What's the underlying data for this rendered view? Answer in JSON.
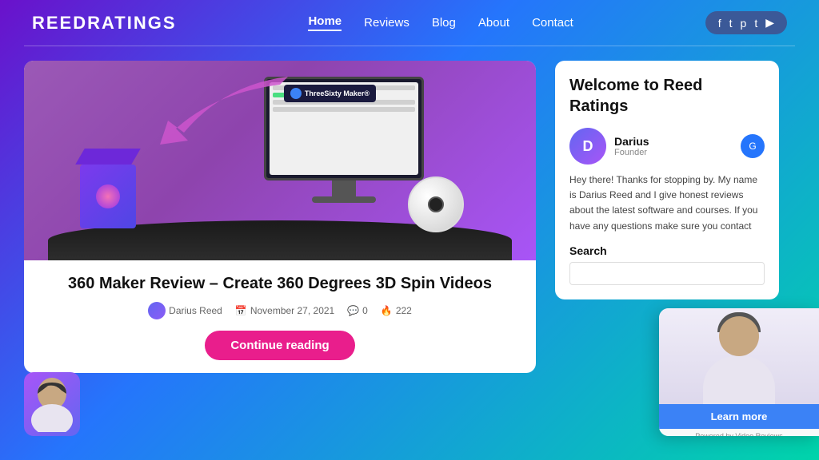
{
  "header": {
    "logo": "ReedRatings",
    "nav": {
      "items": [
        {
          "label": "Home",
          "active": true
        },
        {
          "label": "Reviews",
          "active": false
        },
        {
          "label": "Blog",
          "active": false
        },
        {
          "label": "About",
          "active": false
        },
        {
          "label": "Contact",
          "active": false
        }
      ]
    },
    "social": {
      "icons": [
        "f",
        "t",
        "p",
        "t",
        "yt"
      ]
    }
  },
  "article": {
    "title": "360 Maker Review – Create 360 Degrees 3D Spin Videos",
    "author": "Darius Reed",
    "date": "November 27, 2021",
    "comments": "0",
    "views": "222",
    "continue_reading": "Continue reading"
  },
  "sidebar": {
    "welcome_title": "Welcome to Reed Ratings",
    "author_name": "Darius",
    "author_role": "Founder",
    "description": "Hey there! Thanks for stopping by. My name is Darius Reed and I give honest reviews about the latest software and courses. If you have any questions make sure you contact me and checkout my YouTube channel. I also do video reviews on YouTube.",
    "search_label": "Search",
    "search_placeholder": ""
  },
  "video_popup": {
    "learn_more": "Learn more",
    "powered_by": "Powered by Video Reviews"
  }
}
